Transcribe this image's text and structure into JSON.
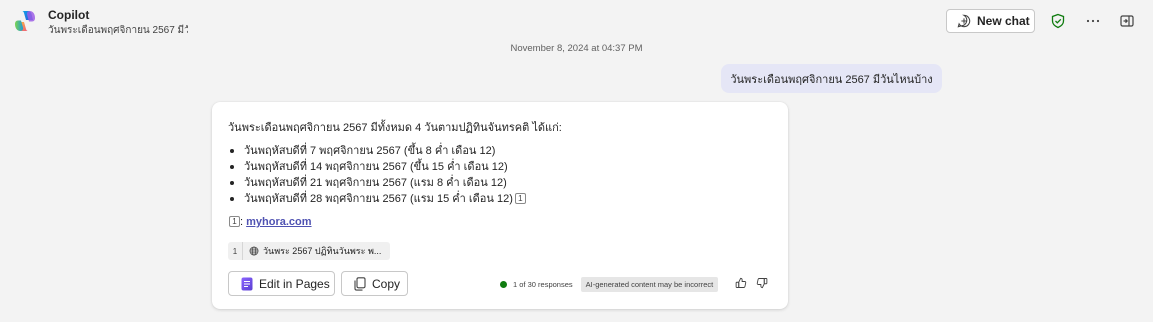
{
  "header": {
    "app_title": "Copilot",
    "chat_subtitle": "วันพระเดือนพฤศจิกายน 2567 มีวั...",
    "new_chat_label": "New chat",
    "icons": [
      "copilot-logo",
      "plus-chat-icon",
      "shield-check-icon",
      "more-icon",
      "open-side-panel-icon"
    ]
  },
  "conversation": {
    "timestamp": "November 8, 2024 at 04:37 PM",
    "user_message": "วันพระเดือนพฤศจิกายน 2567 มีวันไหนบ้าง",
    "response": {
      "intro": "วันพระเดือนพฤศจิกายน 2567 มีทั้งหมด 4 วันตามปฏิทินจันทรคติ ได้แก่:",
      "items": [
        "วันพฤหัสบดีที่ 7 พฤศจิกายน 2567 (ขึ้น 8 ค่ำ เดือน 12)",
        "วันพฤหัสบดีที่ 14 พฤศจิกายน 2567 (ขึ้น 15 ค่ำ เดือน 12)",
        "วันพฤหัสบดีที่ 21 พฤศจิกายน 2567 (แรม 8 ค่ำ เดือน 12)",
        "วันพฤหัสบดีที่ 28 พฤศจิกายน 2567 (แรม 15 ค่ำ เดือน 12)"
      ],
      "citation_marker": "1",
      "source_prefix": ":",
      "source_link": "myhora.com",
      "reference": {
        "number": "1",
        "title": "วันพระ 2567 ปฏิทินวันพระ พ..."
      },
      "edit_button_label": "Edit in Pages",
      "copy_button_label": "Copy",
      "response_count": "1 of 30 responses",
      "ai_disclaimer": "AI-generated content may be incorrect",
      "colors": {
        "accent": "#4f52b2",
        "user_bubble": "#e5e6f6",
        "status_green": "#107c10",
        "shield_green": "#0f7b0f"
      }
    }
  }
}
